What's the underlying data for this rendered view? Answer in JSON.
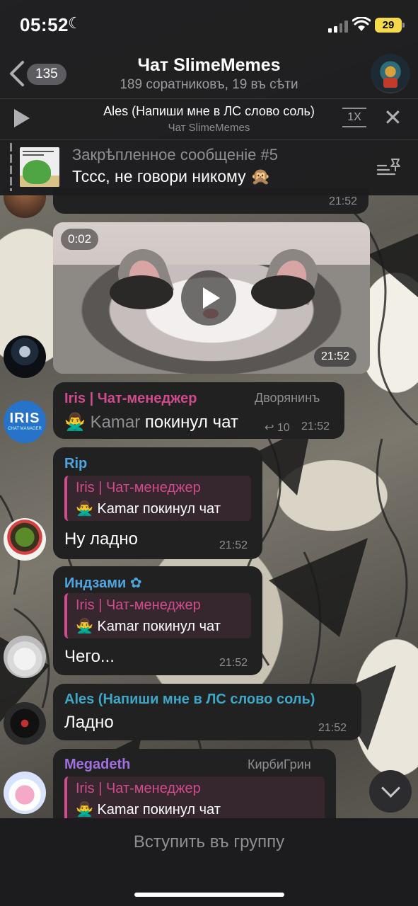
{
  "status": {
    "time": "05:52",
    "battery": "29"
  },
  "header": {
    "back_count": "135",
    "title": "Чат SlimeMemes",
    "subtitle": "189 соратниковъ, 19 въ сѣти"
  },
  "player": {
    "title": "Ales (Напиши мне в ЛС слово соль)",
    "subtitle": "Чат SlimeMemes",
    "speed": "1X"
  },
  "pinned": {
    "title": "Закрѣпленное сообщеніе #5",
    "text": "Тссс, не говори никому 🙊"
  },
  "messages": {
    "top_time": "21:52",
    "video": {
      "duration": "0:02",
      "time": "21:52"
    },
    "iris": {
      "avatar_text": "IRIS",
      "avatar_sub": "CHAT MANAGER",
      "name": "Iris | Чат-менеджер",
      "rank": "Дворянинъ",
      "emoji": "🙅‍♂️",
      "user": "Kamar",
      "action": "покинул чат",
      "replies": "10",
      "time": "21:52"
    },
    "rip": {
      "name": "Rip",
      "reply_name": "Iris | Чат-менеджер",
      "reply_text": "🙅‍♂️ Kamar покинул чат",
      "text": "Ну ладно",
      "time": "21:52"
    },
    "indzami": {
      "name": "Индзами ✿",
      "reply_name": "Iris | Чат-менеджер",
      "reply_text": "🙅‍♂️ Kamar покинул чат",
      "text": "Чего...",
      "time": "21:52"
    },
    "ales": {
      "name": "Ales (Напиши мне в ЛС слово соль)",
      "text": "Ладно",
      "time": "21:52"
    },
    "megadeth": {
      "name": "Megadeth",
      "rank": "КирбиГрин",
      "reply_name": "Iris | Чат-менеджер",
      "reply_text": "🙅‍♂️ Kamar покинул чат"
    }
  },
  "footer": {
    "join_label": "Вступить въ группу"
  },
  "colors": {
    "iris_name": "#d04c8c",
    "rip_name": "#4ea5e0",
    "indzami_name": "#4ea5e0",
    "ales_name": "#3ea6c7",
    "megadeth_name": "#a070e0"
  }
}
